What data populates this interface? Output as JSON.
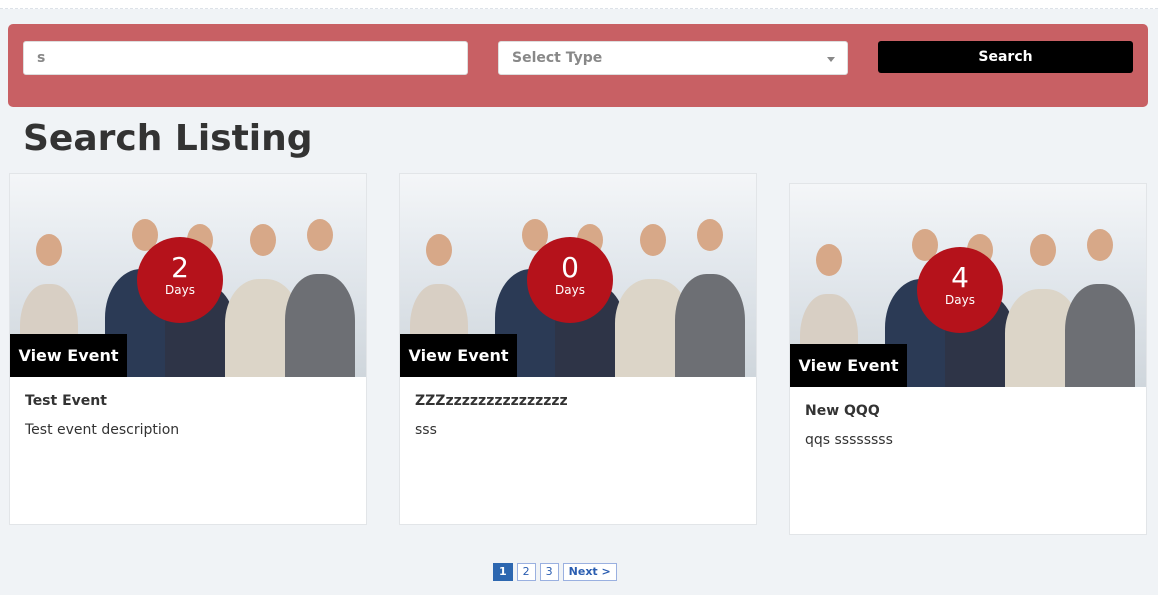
{
  "search": {
    "query": "s",
    "type_placeholder": "Select Type",
    "button": "Search"
  },
  "page_title": "Search Listing",
  "events": [
    {
      "days": "2",
      "days_label": "Days",
      "view": "View Event",
      "title": "Test Event",
      "description": "Test event description"
    },
    {
      "days": "0",
      "days_label": "Days",
      "view": "View Event",
      "title": "ZZZzzzzzzzzzzzzzzz",
      "description": "sss"
    },
    {
      "days": "4",
      "days_label": "Days",
      "view": "View Event",
      "title": "New QQQ",
      "description": "qqs ssssssss"
    }
  ],
  "pagination": {
    "pages": [
      "1",
      "2",
      "3"
    ],
    "current": "1",
    "next": "Next >"
  },
  "colors": {
    "search_bar": "#c86064",
    "badge": "#b5121b",
    "pager_active": "#2d67b0"
  }
}
